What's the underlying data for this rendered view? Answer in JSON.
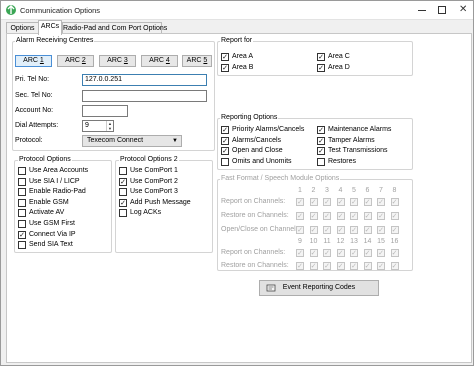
{
  "window": {
    "title": "Communication Options"
  },
  "tabs": [
    "Options",
    "ARCs",
    "Radio-Pad and Com Port Options"
  ],
  "arc_group": {
    "title": "Alarm Receiving Centres",
    "buttons": [
      {
        "prefix": "ARC ",
        "num": "1"
      },
      {
        "prefix": "ARC ",
        "num": "2"
      },
      {
        "prefix": "ARC ",
        "num": "3"
      },
      {
        "prefix": "ARC ",
        "num": "4"
      },
      {
        "prefix": "ARC ",
        "num": "5"
      }
    ],
    "fields": {
      "pri_tel_label": "Pri. Tel No:",
      "pri_tel_value": "127.0.0.251",
      "sec_tel_label": "Sec. Tel No:",
      "sec_tel_value": "",
      "account_label": "Account No:",
      "account_value": "",
      "dial_label": "Dial Attempts:",
      "dial_value": "9",
      "protocol_label": "Protocol:",
      "protocol_value": "Texecom Connect"
    }
  },
  "protocol_options": {
    "title": "Protocol Options",
    "items": [
      {
        "label": "Use Area Accounts",
        "checked": false
      },
      {
        "label": "Use SIA I / LICP",
        "checked": false
      },
      {
        "label": "Enable Radio-Pad",
        "checked": false
      },
      {
        "label": "Enable GSM",
        "checked": false
      },
      {
        "label": "Activate AV",
        "checked": false
      },
      {
        "label": "Use GSM First",
        "checked": false
      },
      {
        "label": "Connect Via IP",
        "checked": true
      },
      {
        "label": "Send SIA Text",
        "checked": false
      }
    ]
  },
  "protocol_options_2": {
    "title": "Protocol Options 2",
    "items": [
      {
        "label": "Use ComPort 1",
        "checked": false
      },
      {
        "label": "Use ComPort 2",
        "checked": true
      },
      {
        "label": "Use ComPort 3",
        "checked": false
      },
      {
        "label": "Add Push Message",
        "checked": true
      },
      {
        "label": "Log ACKs",
        "checked": false
      }
    ]
  },
  "report_for": {
    "title": "Report for",
    "items": [
      {
        "label": "Area A",
        "checked": true
      },
      {
        "label": "Area C",
        "checked": true
      },
      {
        "label": "Area B",
        "checked": true
      },
      {
        "label": "Area D",
        "checked": true
      }
    ]
  },
  "reporting_options": {
    "title": "Reporting Options",
    "items": [
      {
        "label": "Priority Alarms/Cancels",
        "checked": true
      },
      {
        "label": "Maintenance Alarms",
        "checked": true
      },
      {
        "label": "Alarms/Cancels",
        "checked": true
      },
      {
        "label": "Tamper Alarms",
        "checked": true
      },
      {
        "label": "Open and Close",
        "checked": true
      },
      {
        "label": "Test Transmissions",
        "checked": true
      },
      {
        "label": "Omits and Unomits",
        "checked": false
      },
      {
        "label": "Restores",
        "checked": false
      }
    ]
  },
  "fast_format": {
    "title": "Fast Format / Speech Module Options",
    "row_labels": [
      "Report on Channels:",
      "Restore on Channels:",
      "Open/Close on Channels:",
      "Report on Channels:",
      "Restore on Channels:"
    ],
    "channels_top": [
      "1",
      "2",
      "3",
      "4",
      "5",
      "6",
      "7",
      "8"
    ],
    "channels_bottom": [
      "9",
      "10",
      "11",
      "12",
      "13",
      "14",
      "15",
      "16"
    ]
  },
  "event_button": {
    "label": "Event Reporting Codes"
  }
}
